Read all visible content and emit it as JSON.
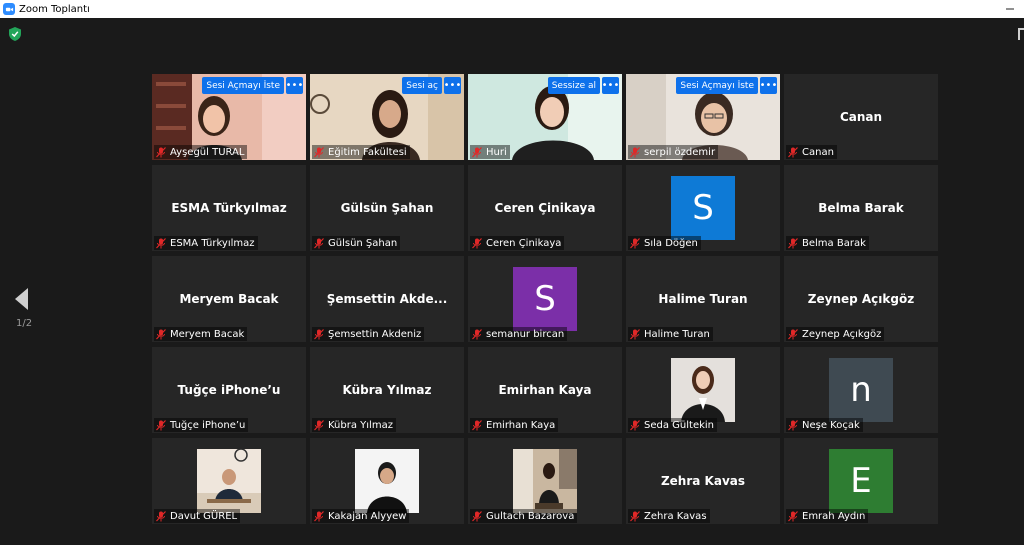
{
  "window": {
    "title": "Zoom Toplantı",
    "accent": "#2d8cff"
  },
  "pager": {
    "page_label": "1/2"
  },
  "colors": {
    "tile_bg": "#262626",
    "active_border": "#e8e86a",
    "action_button": "#0e71eb",
    "muted_mic": "#e02828"
  },
  "participants": [
    {
      "label": "Ayşegül TURAL",
      "type": "video",
      "action": "Sesi Açmayı İste",
      "scene": "woman-bookshelf"
    },
    {
      "label": "Eğitim Fakültesi",
      "type": "video",
      "action": "Sesi aç",
      "scene": "woman-clock"
    },
    {
      "label": "Huri",
      "type": "video",
      "action": "Sessize al",
      "active": true,
      "scene": "woman-light"
    },
    {
      "label": "serpil özdemir",
      "type": "video",
      "action": "Sesi Açmayı İste",
      "scene": "woman-glasses"
    },
    {
      "label": "Canan",
      "type": "name",
      "display": "Canan"
    },
    {
      "label": "ESMA Türkyılmaz",
      "type": "name",
      "display": "ESMA Türkyılmaz"
    },
    {
      "label": "Gülsün Şahan",
      "type": "name",
      "display": "Gülsün Şahan"
    },
    {
      "label": "Ceren Çinikaya",
      "type": "name",
      "display": "Ceren Çinikaya"
    },
    {
      "label": "Sıla Döğen",
      "type": "letter",
      "letter": "S",
      "color": "#0e7ad6"
    },
    {
      "label": "Belma Barak",
      "type": "name",
      "display": "Belma Barak"
    },
    {
      "label": "Meryem Bacak",
      "type": "name",
      "display": "Meryem Bacak"
    },
    {
      "label": "Şemsettin Akdeniz",
      "type": "name",
      "display": "Şemsettin  Akde..."
    },
    {
      "label": "semanur bircan",
      "type": "letter",
      "letter": "S",
      "color": "#7b2fa8"
    },
    {
      "label": "Halime Turan",
      "type": "name",
      "display": "Halime Turan"
    },
    {
      "label": "Zeynep Açıkgöz",
      "type": "name",
      "display": "Zeynep Açıkgöz"
    },
    {
      "label": "Tuğçe iPhone’u",
      "type": "name",
      "display": "Tuğçe iPhone’u"
    },
    {
      "label": "Kübra Yılmaz",
      "type": "name",
      "display": "Kübra Yılmaz"
    },
    {
      "label": "Emirhan Kaya",
      "type": "name",
      "display": "Emirhan Kaya"
    },
    {
      "label": "Seda Gültekin",
      "type": "thumb",
      "scene": "woman-suit"
    },
    {
      "label": "Neşe Koçak",
      "type": "letter",
      "letter": "n",
      "color": "#3f4a52"
    },
    {
      "label": "Davut GÜREL",
      "type": "thumb",
      "scene": "man-desk"
    },
    {
      "label": "Kakajan Alyyew",
      "type": "thumb",
      "scene": "man-white"
    },
    {
      "label": "Gultach Bazarova",
      "type": "thumb",
      "scene": "woman-room"
    },
    {
      "label": "Zehra Kavas",
      "type": "name",
      "display": "Zehra Kavas"
    },
    {
      "label": "Emrah Aydın",
      "type": "letter",
      "letter": "E",
      "color": "#2e7d32"
    }
  ],
  "icons": {
    "shield": "shield-check-icon",
    "mic": "mic-muted-icon",
    "more": "more-options-icon",
    "prev": "chevron-left-icon"
  }
}
